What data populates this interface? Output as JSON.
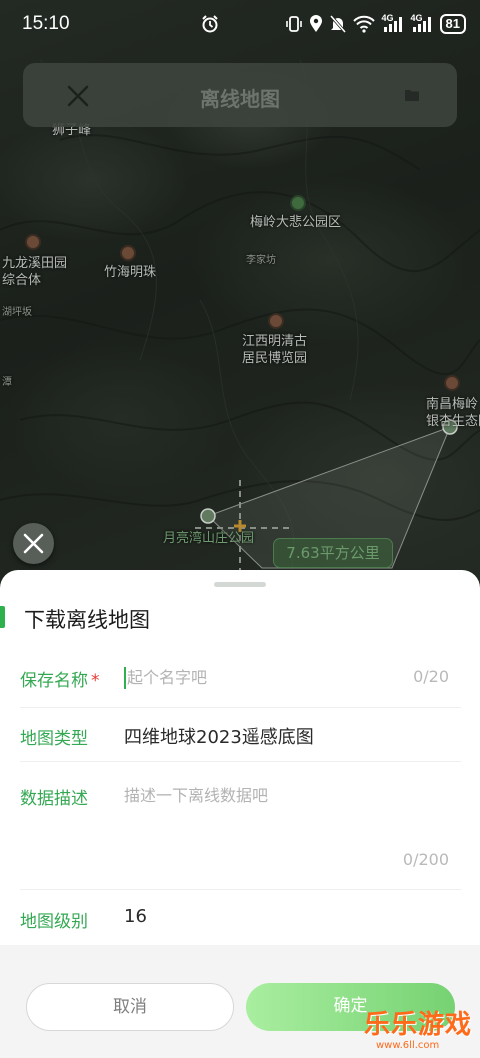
{
  "status_bar": {
    "time": "15:10",
    "network_1": "4G",
    "network_2": "4G",
    "battery": "81"
  },
  "header": {
    "title": "离线地图"
  },
  "map": {
    "labels": {
      "scenic_area": "梅岭大悲公园区",
      "jiulong": "九龙溪田园\n综合体",
      "zhuhai": "竹海明珠",
      "lijia": "李家坊",
      "jiangxi_museum": "江西明清古\n居民博览园",
      "nanchang_meiling": "南昌梅岭\n银杏生态园",
      "yueliang": "月亮湾山庄公园",
      "shizi": "狮子峰",
      "left_edge_1": "潭",
      "left_edge_2": "湖坪坂"
    },
    "area_label": "7.63平方公里"
  },
  "sheet": {
    "title": "下载离线地图",
    "save_name": {
      "label": "保存名称",
      "required_mark": "*",
      "placeholder": "起个名字吧",
      "value": "",
      "counter": "0/20"
    },
    "map_type": {
      "label": "地图类型",
      "value": "四维地球2023遥感底图"
    },
    "description": {
      "label": "数据描述",
      "placeholder": "描述一下离线数据吧",
      "value": "",
      "counter": "0/200"
    },
    "map_level": {
      "label": "地图级别",
      "value": "16"
    },
    "cancel_label": "取消",
    "confirm_label": "确定"
  },
  "watermark": {
    "brand": "乐乐游戏",
    "url": "www.6ll.com"
  },
  "colors": {
    "accent_green": "#34a853",
    "required_red": "#e53935",
    "confirm_gradient_start": "#a9eea0",
    "confirm_gradient_end": "#76d272"
  }
}
